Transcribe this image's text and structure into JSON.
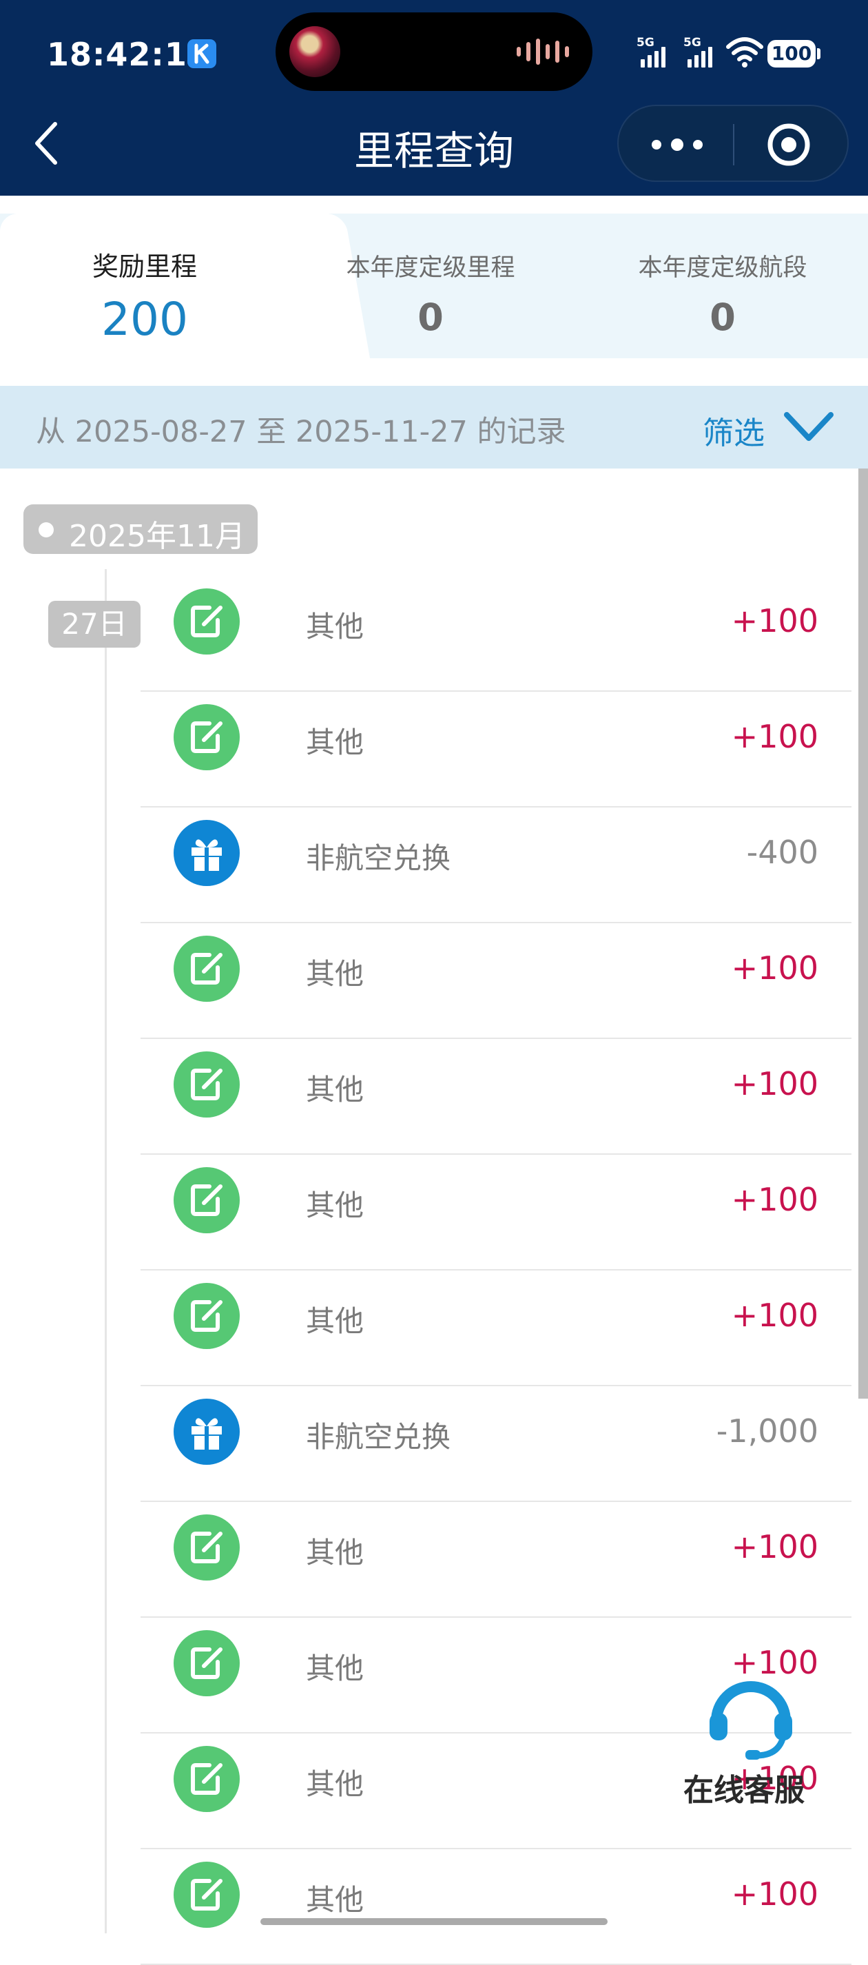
{
  "status_bar": {
    "time": "18:42:15",
    "signal_1_label": "5G",
    "signal_2_label": "5G",
    "battery": "100"
  },
  "nav": {
    "title": "里程查询"
  },
  "tabs": [
    {
      "label": "奖励里程",
      "value": "200",
      "active": true
    },
    {
      "label": "本年度定级里程",
      "value": "0",
      "active": false
    },
    {
      "label": "本年度定级航段",
      "value": "0",
      "active": false
    }
  ],
  "filter": {
    "range_text": "从 2025-08-27 至 2025-11-27 的记录",
    "button_label": "筛选"
  },
  "timeline": {
    "month": "2025年11月",
    "day": "27日"
  },
  "records": [
    {
      "icon": "edit-icon",
      "name": "其他",
      "value": "+100"
    },
    {
      "icon": "edit-icon",
      "name": "其他",
      "value": "+100"
    },
    {
      "icon": "gift-icon",
      "name": "非航空兑换",
      "value": "-400"
    },
    {
      "icon": "edit-icon",
      "name": "其他",
      "value": "+100"
    },
    {
      "icon": "edit-icon",
      "name": "其他",
      "value": "+100"
    },
    {
      "icon": "edit-icon",
      "name": "其他",
      "value": "+100"
    },
    {
      "icon": "edit-icon",
      "name": "其他",
      "value": "+100"
    },
    {
      "icon": "gift-icon",
      "name": "非航空兑换",
      "value": "-1,000"
    },
    {
      "icon": "edit-icon",
      "name": "其他",
      "value": "+100"
    },
    {
      "icon": "edit-icon",
      "name": "其他",
      "value": "+100"
    },
    {
      "icon": "edit-icon",
      "name": "其他",
      "value": "+100"
    },
    {
      "icon": "edit-icon",
      "name": "其他",
      "value": "+100"
    }
  ],
  "service": {
    "label": "在线客服"
  },
  "colors": {
    "header_bg": "#062a5c",
    "accent_blue": "#1a82c2",
    "positive": "#c8124e",
    "negative": "#8c8c8c",
    "edit_icon_bg": "#56c874",
    "gift_icon_bg": "#0f86d4"
  }
}
